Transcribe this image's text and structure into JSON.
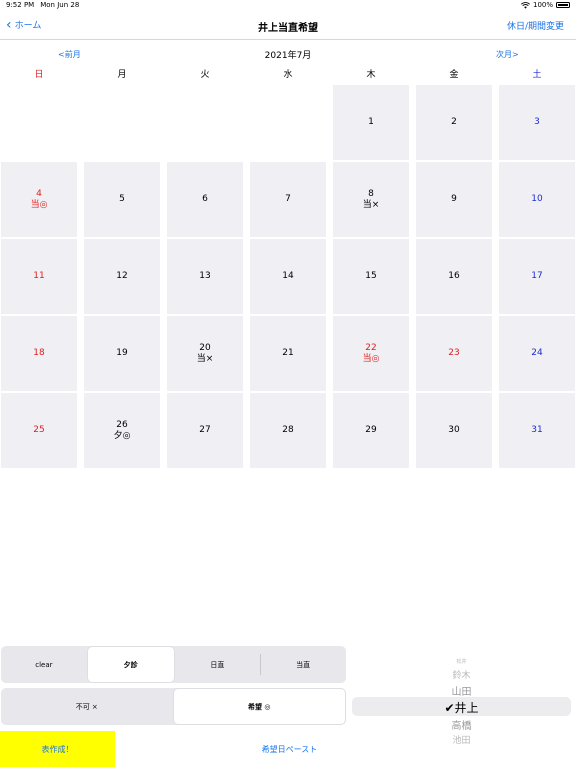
{
  "status_bar": {
    "time": "9:52 PM",
    "date": "Mon Jun 28",
    "battery": "100%"
  },
  "nav": {
    "back_label": "ホーム",
    "title": "井上当直希望",
    "right_label": "休日/期間変更"
  },
  "month": {
    "prev": "<前月",
    "title": "2021年7月",
    "next": "次月>"
  },
  "weekdays": [
    "日",
    "月",
    "火",
    "水",
    "木",
    "金",
    "土"
  ],
  "weeks": [
    [
      {
        "day": "",
        "mark": ""
      },
      {
        "day": "",
        "mark": ""
      },
      {
        "day": "",
        "mark": ""
      },
      {
        "day": "",
        "mark": ""
      },
      {
        "day": "1",
        "mark": ""
      },
      {
        "day": "2",
        "mark": ""
      },
      {
        "day": "3",
        "mark": ""
      }
    ],
    [
      {
        "day": "4",
        "mark": "当◎"
      },
      {
        "day": "5",
        "mark": ""
      },
      {
        "day": "6",
        "mark": ""
      },
      {
        "day": "7",
        "mark": ""
      },
      {
        "day": "8",
        "mark": "当×"
      },
      {
        "day": "9",
        "mark": ""
      },
      {
        "day": "10",
        "mark": ""
      }
    ],
    [
      {
        "day": "11",
        "mark": ""
      },
      {
        "day": "12",
        "mark": ""
      },
      {
        "day": "13",
        "mark": ""
      },
      {
        "day": "14",
        "mark": ""
      },
      {
        "day": "15",
        "mark": ""
      },
      {
        "day": "16",
        "mark": ""
      },
      {
        "day": "17",
        "mark": ""
      }
    ],
    [
      {
        "day": "18",
        "mark": ""
      },
      {
        "day": "19",
        "mark": ""
      },
      {
        "day": "20",
        "mark": "当×"
      },
      {
        "day": "21",
        "mark": ""
      },
      {
        "day": "22",
        "mark": "当◎",
        "holiday": true
      },
      {
        "day": "23",
        "mark": "",
        "holiday": true
      },
      {
        "day": "24",
        "mark": ""
      }
    ],
    [
      {
        "day": "25",
        "mark": ""
      },
      {
        "day": "26",
        "mark": "夕◎"
      },
      {
        "day": "27",
        "mark": ""
      },
      {
        "day": "28",
        "mark": ""
      },
      {
        "day": "29",
        "mark": ""
      },
      {
        "day": "30",
        "mark": ""
      },
      {
        "day": "31",
        "mark": ""
      }
    ]
  ],
  "shift_segment": {
    "options": [
      "clear",
      "夕診",
      "日直",
      "当直"
    ],
    "selected": "夕診"
  },
  "pref_segment": {
    "options": [
      "不可 ×",
      "希望 ◎"
    ],
    "selected": "希望 ◎"
  },
  "buttons": {
    "make": "表作成！",
    "paste": "希望日ペースト"
  },
  "picker": {
    "names": [
      "松井",
      "鈴木",
      "山田",
      "井上",
      "高橋",
      "池田"
    ],
    "selected": "井上",
    "check": "✔"
  },
  "colors": {
    "accent": "#1a73e8",
    "sunday": "#e02020",
    "saturday": "#1c2cd6",
    "make_button_bg": "#ffff00",
    "cell_bg": "#efeff4"
  }
}
